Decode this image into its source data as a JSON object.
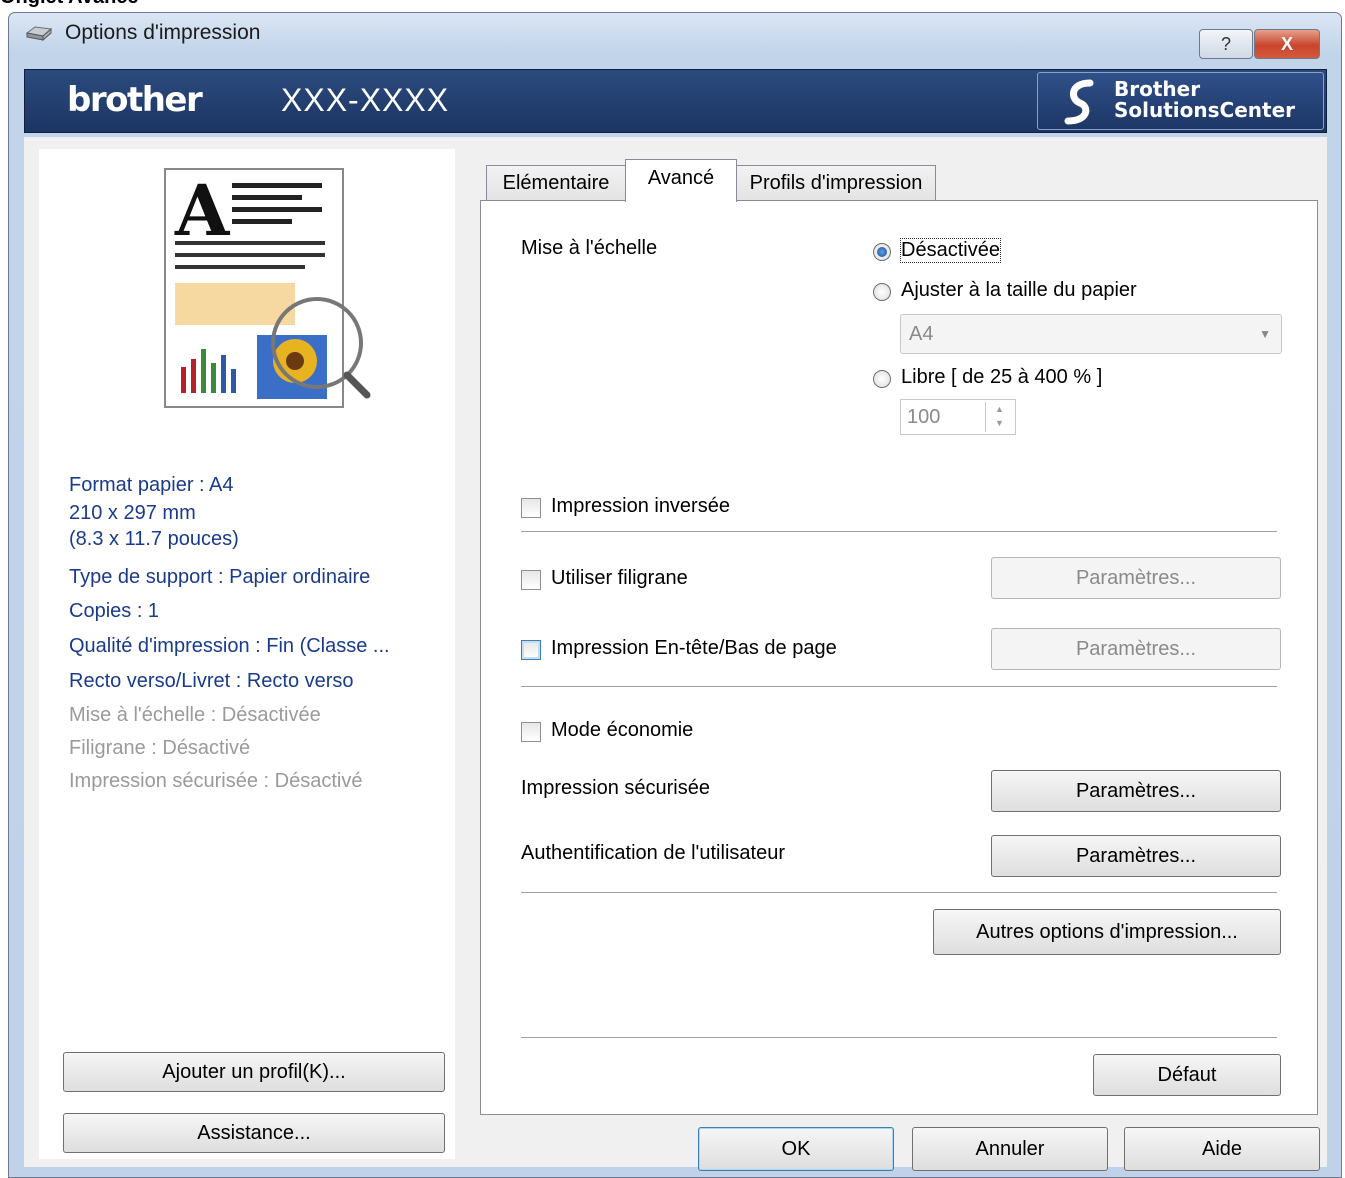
{
  "page_heading": "Onglet Avancé",
  "window": {
    "title": "Options d'impression",
    "help_label": "?",
    "close_label": "X"
  },
  "brand": {
    "logo": "brother",
    "model": "XXX-XXXX",
    "solutions_line1": "Brother",
    "solutions_line2": "SolutionsCenter"
  },
  "summary": {
    "paper_size": "Format papier : A4",
    "dimensions_mm": "210 x 297 mm",
    "dimensions_in": "(8.3 x 11.7 pouces)",
    "media_type": "Type de support : Papier ordinaire",
    "copies": "Copies : 1",
    "quality": "Qualité d'impression : Fin (Classe ...",
    "duplex": "Recto verso/Livret : Recto verso",
    "scaling": "Mise à l'échelle : Désactivée",
    "watermark": "Filigrane : Désactivé",
    "secure_print": "Impression sécurisée : Désactivé"
  },
  "left_buttons": {
    "add_profile": "Ajouter un profil(K)...",
    "support": "Assistance..."
  },
  "tabs": [
    {
      "label": "Elémentaire",
      "active": false
    },
    {
      "label": "Avancé",
      "active": true
    },
    {
      "label": "Profils d'impression",
      "active": false
    }
  ],
  "advanced": {
    "scaling_label": "Mise à l'échelle",
    "scaling_options": {
      "off": "Désactivée",
      "fit": "Ajuster à la taille du papier",
      "free": "Libre [ de 25 à 400 % ]"
    },
    "scaling_selected": "off",
    "fit_paper_value": "A4",
    "free_value": "100",
    "reverse_print": {
      "label": "Impression inversée",
      "checked": false
    },
    "watermark": {
      "label": "Utiliser filigrane",
      "checked": false,
      "settings": "Paramètres..."
    },
    "header_footer": {
      "label": "Impression En-tête/Bas de page",
      "checked": false,
      "settings": "Paramètres..."
    },
    "toner_save": {
      "label": "Mode économie",
      "checked": false
    },
    "secure_print": {
      "label": "Impression sécurisée",
      "settings": "Paramètres..."
    },
    "user_auth": {
      "label": "Authentification de l'utilisateur",
      "settings": "Paramètres..."
    },
    "other_options": "Autres options d'impression...",
    "default": "Défaut"
  },
  "dialog_buttons": {
    "ok": "OK",
    "cancel": "Annuler",
    "help": "Aide"
  },
  "colors": {
    "summary_blue": "#1a3b8c",
    "brand_bar": "#1c3563",
    "close_red": "#c8452c"
  }
}
